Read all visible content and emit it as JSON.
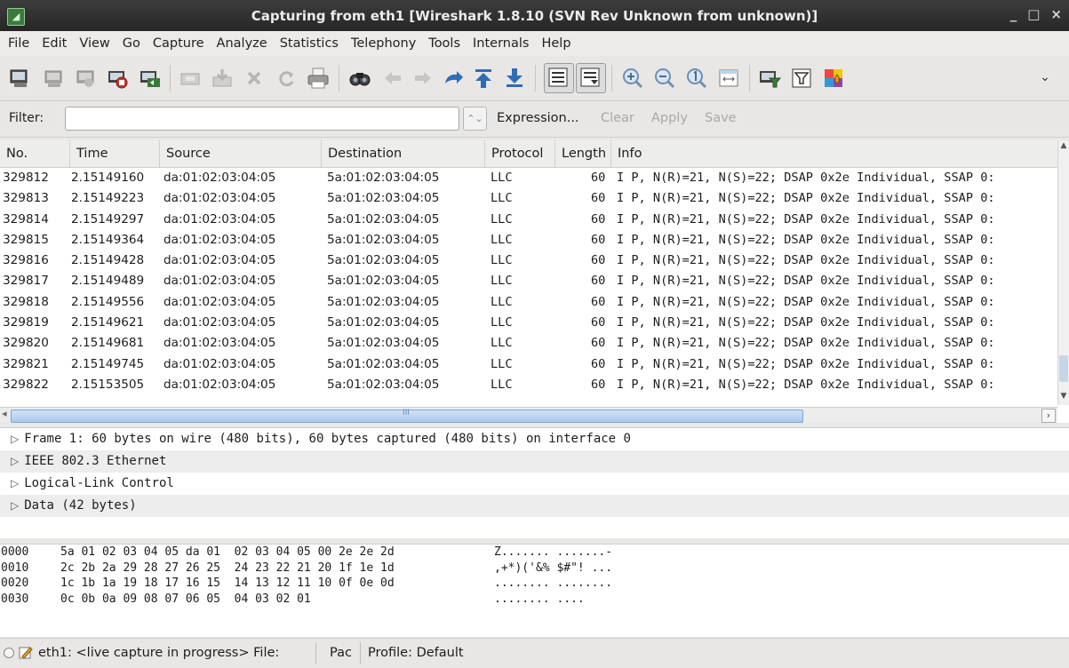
{
  "window": {
    "title": "Capturing from eth1   [Wireshark 1.8.10  (SVN Rev Unknown from unknown)]",
    "controls": [
      "_",
      "□",
      "×"
    ]
  },
  "menu": [
    "File",
    "Edit",
    "View",
    "Go",
    "Capture",
    "Analyze",
    "Statistics",
    "Telephony",
    "Tools",
    "Internals",
    "Help"
  ],
  "toolbar": {
    "icons": [
      "interface-list-icon",
      "capture-options-icon",
      "start-capture-icon",
      "stop-capture-icon",
      "restart-capture-icon",
      "open-file-icon",
      "save-file-icon",
      "close-file-icon",
      "reload-icon",
      "print-icon",
      "find-packet-icon",
      "go-back-icon",
      "go-forward-icon",
      "go-to-packet-icon",
      "go-first-icon",
      "go-last-icon",
      "colorize-icon",
      "autoscroll-icon",
      "zoom-in-icon",
      "zoom-out-icon",
      "normal-size-icon",
      "resize-columns-icon",
      "capture-filters-icon",
      "display-filters-icon",
      "coloring-rules-icon",
      "more-chevron-icon"
    ]
  },
  "filter": {
    "label": "Filter:",
    "value": "",
    "expression": "Expression...",
    "clear": "Clear",
    "apply": "Apply",
    "save": "Save"
  },
  "packet_list": {
    "columns": [
      "No.",
      "Time",
      "Source",
      "Destination",
      "Protocol",
      "Length",
      "Info"
    ],
    "rows": [
      {
        "no": "329812",
        "time": "2.15149160",
        "source": "da:01:02:03:04:05",
        "destination": "5a:01:02:03:04:05",
        "protocol": "LLC",
        "length": "60",
        "info": "I P, N(R)=21, N(S)=22; DSAP 0x2e Individual, SSAP 0:"
      },
      {
        "no": "329813",
        "time": "2.15149223",
        "source": "da:01:02:03:04:05",
        "destination": "5a:01:02:03:04:05",
        "protocol": "LLC",
        "length": "60",
        "info": "I P, N(R)=21, N(S)=22; DSAP 0x2e Individual, SSAP 0:"
      },
      {
        "no": "329814",
        "time": "2.15149297",
        "source": "da:01:02:03:04:05",
        "destination": "5a:01:02:03:04:05",
        "protocol": "LLC",
        "length": "60",
        "info": "I P, N(R)=21, N(S)=22; DSAP 0x2e Individual, SSAP 0:"
      },
      {
        "no": "329815",
        "time": "2.15149364",
        "source": "da:01:02:03:04:05",
        "destination": "5a:01:02:03:04:05",
        "protocol": "LLC",
        "length": "60",
        "info": "I P, N(R)=21, N(S)=22; DSAP 0x2e Individual, SSAP 0:"
      },
      {
        "no": "329816",
        "time": "2.15149428",
        "source": "da:01:02:03:04:05",
        "destination": "5a:01:02:03:04:05",
        "protocol": "LLC",
        "length": "60",
        "info": "I P, N(R)=21, N(S)=22; DSAP 0x2e Individual, SSAP 0:"
      },
      {
        "no": "329817",
        "time": "2.15149489",
        "source": "da:01:02:03:04:05",
        "destination": "5a:01:02:03:04:05",
        "protocol": "LLC",
        "length": "60",
        "info": "I P, N(R)=21, N(S)=22; DSAP 0x2e Individual, SSAP 0:"
      },
      {
        "no": "329818",
        "time": "2.15149556",
        "source": "da:01:02:03:04:05",
        "destination": "5a:01:02:03:04:05",
        "protocol": "LLC",
        "length": "60",
        "info": "I P, N(R)=21, N(S)=22; DSAP 0x2e Individual, SSAP 0:"
      },
      {
        "no": "329819",
        "time": "2.15149621",
        "source": "da:01:02:03:04:05",
        "destination": "5a:01:02:03:04:05",
        "protocol": "LLC",
        "length": "60",
        "info": "I P, N(R)=21, N(S)=22; DSAP 0x2e Individual, SSAP 0:"
      },
      {
        "no": "329820",
        "time": "2.15149681",
        "source": "da:01:02:03:04:05",
        "destination": "5a:01:02:03:04:05",
        "protocol": "LLC",
        "length": "60",
        "info": "I P, N(R)=21, N(S)=22; DSAP 0x2e Individual, SSAP 0:"
      },
      {
        "no": "329821",
        "time": "2.15149745",
        "source": "da:01:02:03:04:05",
        "destination": "5a:01:02:03:04:05",
        "protocol": "LLC",
        "length": "60",
        "info": "I P, N(R)=21, N(S)=22; DSAP 0x2e Individual, SSAP 0:"
      },
      {
        "no": "329822",
        "time": "2.15153505",
        "source": "da:01:02:03:04:05",
        "destination": "5a:01:02:03:04:05",
        "protocol": "LLC",
        "length": "60",
        "info": "I P, N(R)=21, N(S)=22; DSAP 0x2e Individual, SSAP 0:"
      }
    ],
    "hscroll_marker": "III"
  },
  "details": [
    "Frame 1: 60 bytes on wire (480 bits), 60 bytes captured (480 bits) on interface 0",
    "IEEE 802.3 Ethernet",
    "Logical-Link Control",
    "Data (42 bytes)"
  ],
  "bytes": [
    {
      "offset": "0000",
      "hex": "5a 01 02 03 04 05 da 01  02 03 04 05 00 2e 2e 2d",
      "ascii": "Z....... .......-"
    },
    {
      "offset": "0010",
      "hex": "2c 2b 2a 29 28 27 26 25  24 23 22 21 20 1f 1e 1d",
      "ascii": ",+*)('&% $#\"! ..."
    },
    {
      "offset": "0020",
      "hex": "1c 1b 1a 19 18 17 16 15  14 13 12 11 10 0f 0e 0d",
      "ascii": "........ ........"
    },
    {
      "offset": "0030",
      "hex": "0c 0b 0a 09 08 07 06 05  04 03 02 01",
      "ascii": "........ ...."
    }
  ],
  "status": {
    "capture": "eth1: <live capture in progress> File:",
    "packets": "Pac",
    "profile": "Profile: Default"
  },
  "colors": {
    "titlebar": "#2e2e2e",
    "hscroll_thumb": "#a9c9ea",
    "start_capture": "#c0392b"
  }
}
